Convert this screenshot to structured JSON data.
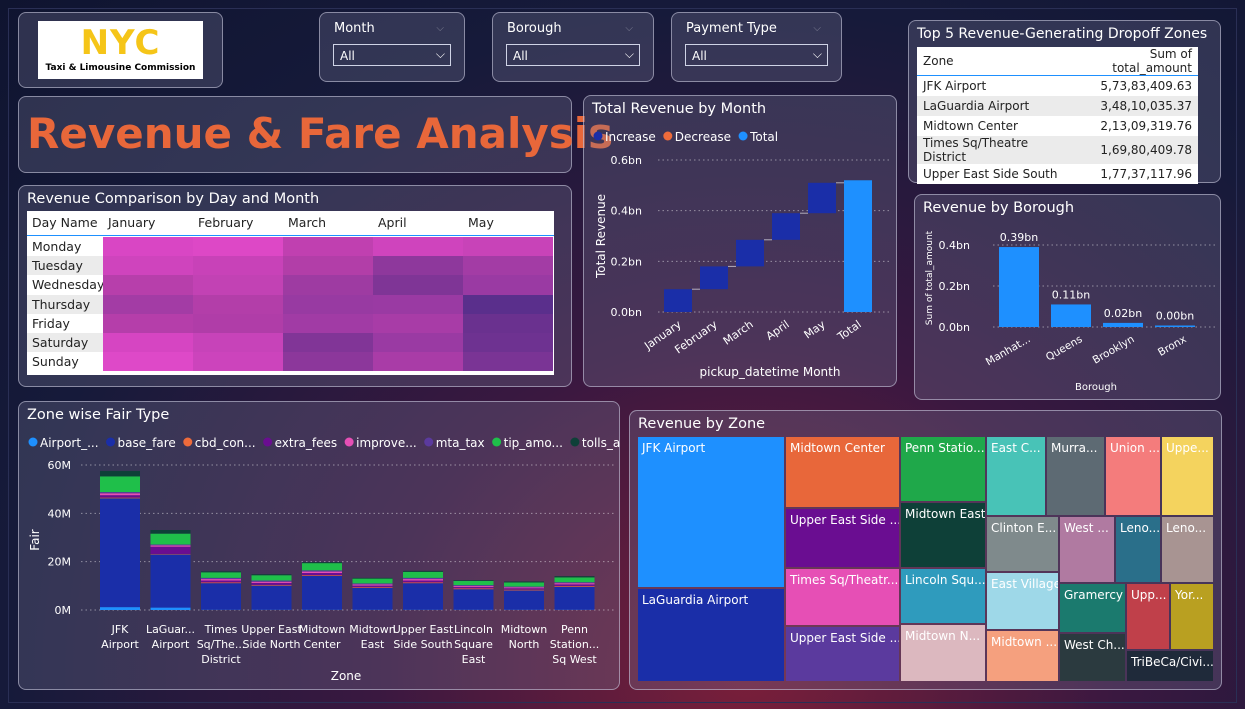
{
  "logo": {
    "text": "NYC",
    "subtitle": "Taxi & Limousine Commission"
  },
  "filters": [
    {
      "label": "Month",
      "value": "All"
    },
    {
      "label": "Borough",
      "value": "All"
    },
    {
      "label": "Payment Type",
      "value": "All"
    }
  ],
  "main_title": "Revenue & Fare Analysis",
  "colors": {
    "accent": "#e8673a",
    "increase": "#1a2ea8",
    "decrease": "#ee6b3b",
    "total": "#1e90ff"
  },
  "top5": {
    "title": "Top 5 Revenue-Generating Dropoff Zones",
    "col1": "Zone",
    "col2": "Sum of total_amount",
    "rows": [
      {
        "zone": "JFK Airport",
        "amount": "5,73,83,409.63"
      },
      {
        "zone": "LaGuardia Airport",
        "amount": "3,48,10,035.37"
      },
      {
        "zone": "Midtown Center",
        "amount": "2,13,09,319.76"
      },
      {
        "zone": "Times Sq/Theatre District",
        "amount": "1,69,80,409.78"
      },
      {
        "zone": "Upper East Side South",
        "amount": "1,77,37,117.96"
      }
    ]
  },
  "heatmap": {
    "title": "Revenue Comparison by Day and Month",
    "corner": "Day Name",
    "months": [
      "January",
      "February",
      "March",
      "April",
      "May"
    ],
    "days": [
      "Monday",
      "Tuesday",
      "Wednesday",
      "Thursday",
      "Friday",
      "Saturday",
      "Sunday"
    ],
    "colors": [
      [
        "#d946c4",
        "#dd48c6",
        "#c040b0",
        "#cf44bd",
        "#c843b8"
      ],
      [
        "#cf44bd",
        "#c842b8",
        "#b23ea8",
        "#8e389c",
        "#a33ca5"
      ],
      [
        "#b73fab",
        "#c242b4",
        "#9e3ba2",
        "#7f3596",
        "#9a3aa3"
      ],
      [
        "#a33ca5",
        "#b33ea9",
        "#983aa2",
        "#9a3aa3",
        "#5a2f8c"
      ],
      [
        "#b53eaa",
        "#b03da8",
        "#a13ba5",
        "#a83ca7",
        "#6a318f"
      ],
      [
        "#d645c2",
        "#c743b9",
        "#813597",
        "#9a3aa3",
        "#6e3291"
      ],
      [
        "#de49c8",
        "#cc44bc",
        "#8c379b",
        "#a93ca7",
        "#7a3495"
      ]
    ]
  },
  "legend_waterfall": [
    "Increase",
    "Decrease",
    "Total"
  ],
  "zone_legend": [
    "Airport_...",
    "base_fare",
    "cbd_con...",
    "extra_fees",
    "improve...",
    "mta_tax",
    "tip_amo...",
    "tolls_am..."
  ],
  "zone_legend_colors": [
    "#1e90ff",
    "#1a2ea8",
    "#ee6b3b",
    "#6a0d91",
    "#e64fb5",
    "#5b3a9e",
    "#1fbf4a",
    "#0e4038"
  ],
  "chart_data": [
    {
      "type": "waterfall",
      "title": "Total Revenue by Month",
      "xlabel": "pickup_datetime Month",
      "ylabel": "Total Revenue",
      "categories": [
        "January",
        "February",
        "March",
        "April",
        "May",
        "Total"
      ],
      "values": [
        0.09,
        0.09,
        0.105,
        0.105,
        0.12,
        0.52
      ],
      "yticks": [
        "0.0bn",
        "0.2bn",
        "0.4bn",
        "0.6bn"
      ],
      "ylim": [
        0,
        0.6
      ]
    },
    {
      "type": "bar",
      "title": "Revenue by Borough",
      "xlabel": "Borough",
      "ylabel": "Sum of total_amount",
      "categories": [
        "Manhat...",
        "Queens",
        "Brooklyn",
        "Bronx"
      ],
      "values": [
        0.39,
        0.11,
        0.02,
        0.004
      ],
      "data_labels": [
        "0.39bn",
        "0.11bn",
        "0.02bn",
        "0.00bn"
      ],
      "yticks": [
        "0.0bn",
        "0.2bn",
        "0.4bn"
      ],
      "ylim": [
        0,
        0.4
      ]
    },
    {
      "type": "bar",
      "stacked": true,
      "title": "Zone wise Fair Type",
      "xlabel": "Zone",
      "ylabel": "Fair",
      "yticks": [
        "0M",
        "20M",
        "40M",
        "60M"
      ],
      "ylim": [
        0,
        60
      ],
      "categories": [
        "JFK Airport",
        "LaGuar... Airport",
        "Times Sq/The... District",
        "Upper East Side North",
        "Midtown Center",
        "Midtown East",
        "Upper East Side South",
        "Lincoln Square East",
        "Midtown North",
        "Penn Station... Sq West"
      ],
      "series": [
        {
          "name": "Airport_...",
          "values": [
            1.2,
            1.0,
            0.1,
            0.1,
            0.1,
            0.1,
            0.1,
            0.1,
            0.1,
            0.1
          ]
        },
        {
          "name": "base_fare",
          "values": [
            45,
            22,
            11,
            10,
            14,
            9,
            11,
            8.5,
            8,
            9.5
          ]
        },
        {
          "name": "cbd_con...",
          "values": [
            0.3,
            0.2,
            0.3,
            0.3,
            0.3,
            0.3,
            0.3,
            0.3,
            0.3,
            0.3
          ]
        },
        {
          "name": "extra_fees",
          "values": [
            1.0,
            3.0,
            0.8,
            0.8,
            0.9,
            0.7,
            0.8,
            0.6,
            0.6,
            0.7
          ]
        },
        {
          "name": "improve...",
          "values": [
            0.8,
            0.5,
            0.6,
            0.5,
            0.6,
            0.5,
            0.6,
            0.4,
            0.4,
            0.5
          ]
        },
        {
          "name": "mta_tax",
          "values": [
            0.5,
            0.4,
            0.5,
            0.5,
            0.5,
            0.4,
            0.5,
            0.4,
            0.3,
            0.4
          ]
        },
        {
          "name": "tip_amo...",
          "values": [
            6.5,
            4.5,
            2.3,
            2.2,
            3.0,
            2.0,
            2.5,
            1.7,
            1.7,
            2.0
          ]
        },
        {
          "name": "tolls_am...",
          "values": [
            2.2,
            1.5,
            0.4,
            0.4,
            0.4,
            0.3,
            0.4,
            0.3,
            0.4,
            0.5
          ]
        }
      ]
    },
    {
      "type": "treemap",
      "title": "Revenue by Zone",
      "items": [
        {
          "label": "JFK Airport",
          "color": "#1e90ff"
        },
        {
          "label": "LaGuardia Airport",
          "color": "#1a2ea8"
        },
        {
          "label": "Midtown Center",
          "color": "#e8673a"
        },
        {
          "label": "Upper East Side ...",
          "color": "#6a0d91"
        },
        {
          "label": "Times Sq/Theatr...",
          "color": "#e64fb5"
        },
        {
          "label": "Upper East Side ...",
          "color": "#5b3a9e"
        },
        {
          "label": "Penn Statio...",
          "color": "#1fa84a"
        },
        {
          "label": "Midtown East",
          "color": "#0e4038"
        },
        {
          "label": "Lincoln Squ...",
          "color": "#2f9bbd"
        },
        {
          "label": "Midtown N...",
          "color": "#dcb8bf"
        },
        {
          "label": "East C...",
          "color": "#48c3b7"
        },
        {
          "label": "Murra...",
          "color": "#5d6a73"
        },
        {
          "label": "Union ...",
          "color": "#f47c7c"
        },
        {
          "label": "Uppe...",
          "color": "#f4d35e"
        },
        {
          "label": "Clinton E...",
          "color": "#7f8a8c"
        },
        {
          "label": "West ...",
          "color": "#b07aa1"
        },
        {
          "label": "Leno...",
          "color": "#2a6f8a"
        },
        {
          "label": "Leno...",
          "color": "#a89492"
        },
        {
          "label": "East Village",
          "color": "#9ed8e8"
        },
        {
          "label": "Midtown ...",
          "color": "#f5a07e"
        },
        {
          "label": "Gramercy",
          "color": "#1b7a6e"
        },
        {
          "label": "Upp...",
          "color": "#c0404a"
        },
        {
          "label": "Yor...",
          "color": "#b9a021"
        },
        {
          "label": "West Ch...",
          "color": "#2b3a3f"
        },
        {
          "label": "TriBeCa/Civi...",
          "color": "#1f2a3a"
        }
      ]
    }
  ]
}
